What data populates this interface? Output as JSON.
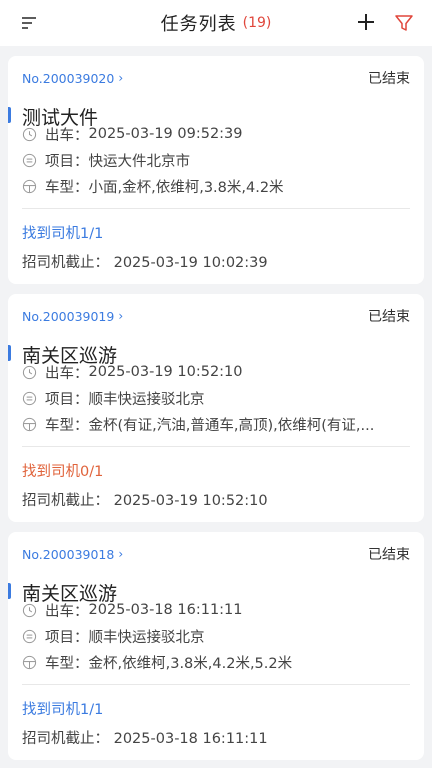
{
  "header": {
    "title": "任务列表",
    "count": "(19)"
  },
  "labels": {
    "depart": "出车：",
    "project": "项目：",
    "car_type": "车型："
  },
  "colors": {
    "accent": "#3b7be0",
    "alert": "#e0463b",
    "orange": "#e0633b"
  },
  "cards": [
    {
      "order_no": "No.200039020",
      "status": "已结束",
      "title": "测试大件",
      "depart": "2025-03-19 09:52:39",
      "project": "快运大件北京市",
      "car_type": "小面,金杯,依维柯,3.8米,4.2米",
      "found": "找到司机1/1",
      "deadline": "招司机截止：  2025-03-19 10:02:39"
    },
    {
      "order_no": "No.200039019",
      "status": "已结束",
      "title": "南关区巡游",
      "depart": "2025-03-19 10:52:10",
      "project": "顺丰快运接驳北京",
      "car_type": "金杯(有证,汽油,普通车,高顶),依维柯(有证,...",
      "found": "找到司机0/1",
      "deadline": "招司机截止：  2025-03-19 10:52:10"
    },
    {
      "order_no": "No.200039018",
      "status": "已结束",
      "title": "南关区巡游",
      "depart": "2025-03-18 16:11:11",
      "project": "顺丰快运接驳北京",
      "car_type": "金杯,依维柯,3.8米,4.2米,5.2米",
      "found": "找到司机1/1",
      "deadline": "招司机截止：  2025-03-18 16:11:11"
    }
  ]
}
